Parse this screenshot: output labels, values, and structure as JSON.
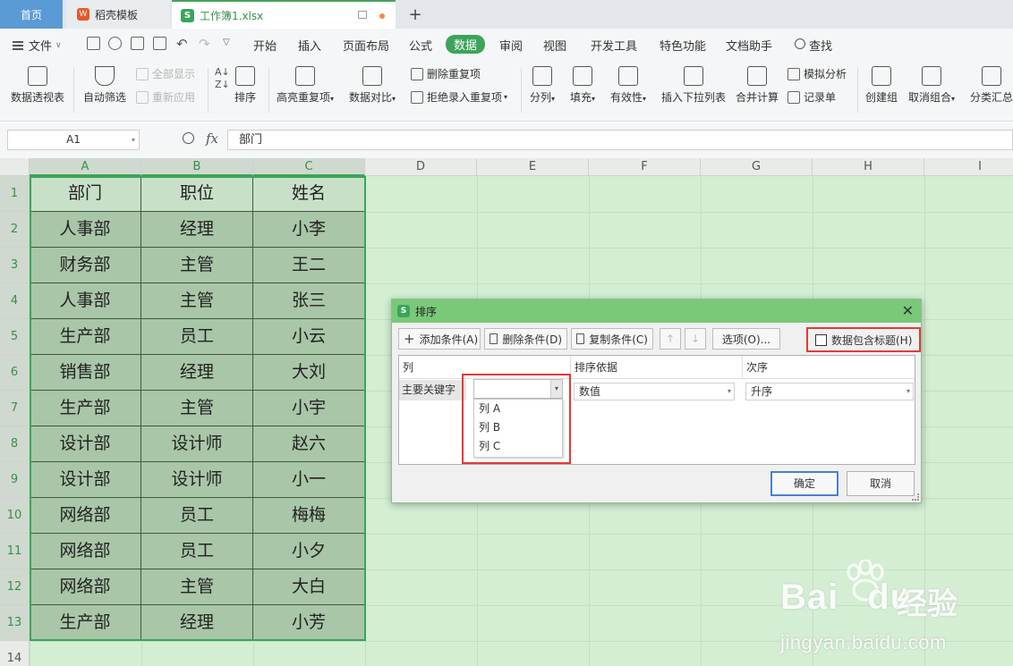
{
  "tabs": {
    "home": "首页",
    "template": "稻壳模板",
    "file": "工作簿1.xlsx"
  },
  "menu": {
    "file_label": "文件",
    "items": [
      "开始",
      "插入",
      "页面布局",
      "公式",
      "数据",
      "审阅",
      "视图",
      "开发工具",
      "特色功能",
      "文档助手",
      "查找"
    ],
    "active": "数据"
  },
  "ribbon": {
    "pivot": "数据透视表",
    "autofilter": "自动筛选",
    "show_all": "全部显示",
    "reapply": "重新应用",
    "sort": "排序",
    "highlight_dup": "高亮重复项",
    "compare": "数据对比",
    "remove_dup": "删除重复项",
    "reject_dup": "拒绝录入重复项",
    "split": "分列",
    "fill": "填充",
    "validity": "有效性",
    "insert_dropdown": "插入下拉列表",
    "consolidate": "合并计算",
    "what_if": "模拟分析",
    "record_form": "记录单",
    "group": "创建组",
    "ungroup": "取消组合",
    "subtotal": "分类汇总"
  },
  "formula_bar": {
    "name_box": "A1",
    "fx": "fx",
    "content": "部门"
  },
  "sheet": {
    "columns": [
      "A",
      "B",
      "C",
      "D",
      "E",
      "F",
      "G",
      "H",
      "I"
    ],
    "row_numbers": [
      "1",
      "2",
      "3",
      "4",
      "5",
      "6",
      "7",
      "8",
      "9",
      "10",
      "11",
      "12",
      "13",
      "14"
    ],
    "rows": [
      [
        "部门",
        "职位",
        "姓名"
      ],
      [
        "人事部",
        "经理",
        "小李"
      ],
      [
        "财务部",
        "主管",
        "王二"
      ],
      [
        "人事部",
        "主管",
        "张三"
      ],
      [
        "生产部",
        "员工",
        "小云"
      ],
      [
        "销售部",
        "经理",
        "大刘"
      ],
      [
        "生产部",
        "主管",
        "小宇"
      ],
      [
        "设计部",
        "设计师",
        "赵六"
      ],
      [
        "设计部",
        "设计师",
        "小一"
      ],
      [
        "网络部",
        "员工",
        "梅梅"
      ],
      [
        "网络部",
        "员工",
        "小夕"
      ],
      [
        "网络部",
        "主管",
        "大白"
      ],
      [
        "生产部",
        "经理",
        "小芳"
      ]
    ]
  },
  "dialog": {
    "title": "排序",
    "add_condition": "添加条件(A)",
    "delete_condition": "删除条件(D)",
    "copy_condition": "复制条件(C)",
    "options": "选项(O)...",
    "header_checkbox": "数据包含标题(H)",
    "col_header": "列",
    "sort_on_header": "排序依据",
    "order_header": "次序",
    "primary_key": "主要关键字",
    "sort_on_value": "数值",
    "order_value": "升序",
    "column_options": [
      "列 A",
      "列 B",
      "列 C"
    ],
    "ok": "确定",
    "cancel": "取消"
  },
  "watermark": {
    "brand": "Bai",
    "brand2": "du",
    "jy": "经验",
    "url": "jingyan.baidu.com"
  },
  "colors": {
    "accent": "#3aa55a",
    "highlight_red": "#e53935",
    "grid_bg": "#d3eed2"
  }
}
